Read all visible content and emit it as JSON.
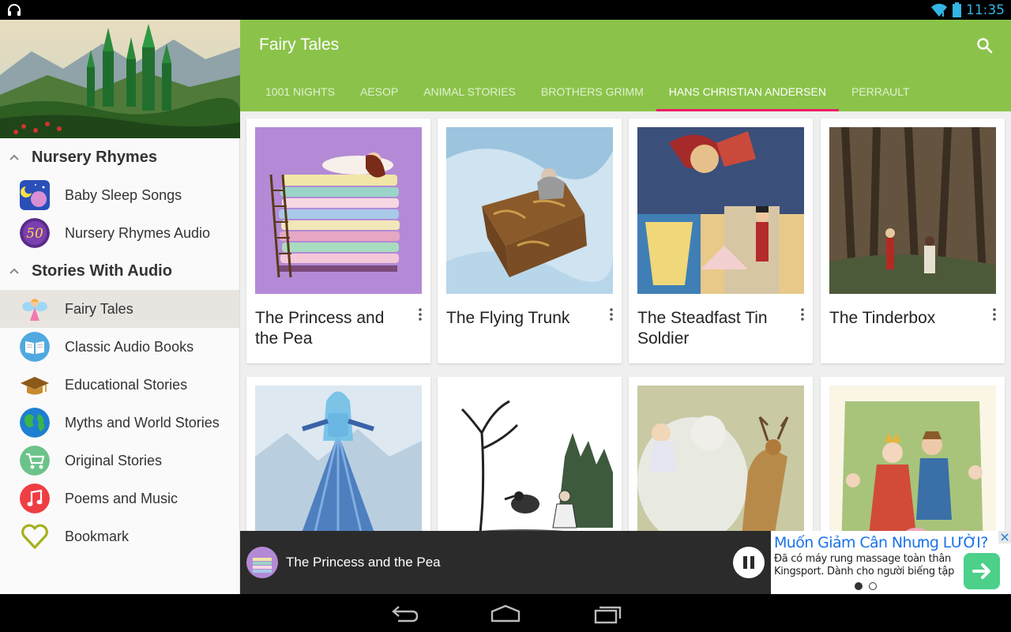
{
  "status_bar": {
    "time": "11:35",
    "icons": [
      "headset-icon",
      "wifi-icon",
      "battery-icon"
    ]
  },
  "sidebar": {
    "sections": [
      {
        "title": "Nursery Rhymes",
        "items": [
          {
            "label": "Baby Sleep Songs",
            "icon": "baby-sleep-icon"
          },
          {
            "label": "Nursery Rhymes Audio",
            "icon": "fifty-badge-icon"
          }
        ]
      },
      {
        "title": "Stories With Audio",
        "items": [
          {
            "label": "Fairy Tales",
            "icon": "fairy-icon",
            "active": true
          },
          {
            "label": "Classic Audio Books",
            "icon": "book-icon"
          },
          {
            "label": "Educational Stories",
            "icon": "graduation-cap-icon"
          },
          {
            "label": "Myths and World Stories",
            "icon": "globe-icon"
          },
          {
            "label": "Original Stories",
            "icon": "stroller-icon"
          },
          {
            "label": "Poems and Music",
            "icon": "music-note-icon"
          },
          {
            "label": "Bookmark",
            "icon": "heart-icon"
          }
        ]
      }
    ]
  },
  "appbar": {
    "title": "Fairy Tales",
    "tabs": [
      {
        "label": "1001 NIGHTS"
      },
      {
        "label": "AESOP"
      },
      {
        "label": "ANIMAL STORIES"
      },
      {
        "label": "BROTHERS GRIMM"
      },
      {
        "label": "HANS CHRISTIAN ANDERSEN",
        "active": true
      },
      {
        "label": "PERRAULT"
      }
    ]
  },
  "stories": [
    {
      "title": "The Princess and the Pea"
    },
    {
      "title": "The Flying Trunk"
    },
    {
      "title": "The Steadfast Tin Soldier"
    },
    {
      "title": "The Tinderbox"
    },
    {
      "title": ""
    },
    {
      "title": ""
    },
    {
      "title": ""
    },
    {
      "title": ""
    }
  ],
  "player": {
    "now_playing": "The Princess and the Pea",
    "state": "playing"
  },
  "ad": {
    "headline": "Muốn Giảm Cân Nhưng LƯỜI?",
    "body": "Đã có máy rung massage toàn thân Kingsport. Dành cho người biếng tập",
    "pager": {
      "count": 2,
      "current": 0
    }
  },
  "colors": {
    "appbar": "#8bc34a",
    "tab_indicator": "#e91e63",
    "status_icons": "#33b5e5"
  }
}
